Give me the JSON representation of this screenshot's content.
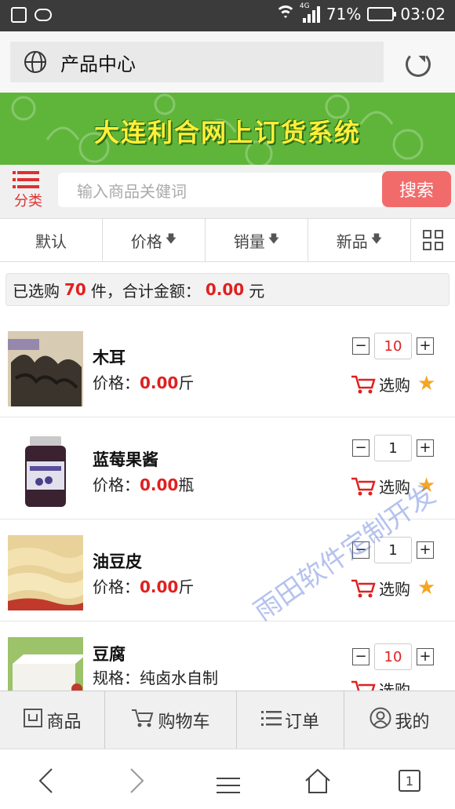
{
  "status_bar": {
    "network": "4G",
    "battery": "71%",
    "time": "03:02"
  },
  "browser": {
    "title": "产品中心"
  },
  "banner": {
    "text": "大连利合网上订货系统"
  },
  "search": {
    "category_label": "分类",
    "placeholder": "输入商品关健词",
    "button_label": "搜索"
  },
  "sort": {
    "items": [
      {
        "label": "默认",
        "arrow": ""
      },
      {
        "label": "价格",
        "arrow": "🡇"
      },
      {
        "label": "销量",
        "arrow": "🡇"
      },
      {
        "label": "新品",
        "arrow": "🡇"
      }
    ]
  },
  "summary": {
    "prefix": "已选购",
    "count": "70",
    "middle": "件，合计金额：",
    "amount": "0.00",
    "suffix": "元"
  },
  "products": [
    {
      "name": "木耳",
      "detail_label": "价格：",
      "price": "0.00",
      "unit": "斤",
      "qty": "10",
      "qty_highlight": true,
      "select_label": "选购"
    },
    {
      "name": "蓝莓果酱",
      "detail_label": "价格：",
      "price": "0.00",
      "unit": "瓶",
      "qty": "1",
      "qty_highlight": false,
      "select_label": "选购"
    },
    {
      "name": "油豆皮",
      "detail_label": "价格：",
      "price": "0.00",
      "unit": "斤",
      "qty": "1",
      "qty_highlight": false,
      "select_label": "选购"
    },
    {
      "name": "豆腐",
      "detail_label": "规格：",
      "price": "",
      "unit": "纯卤水自制",
      "qty": "10",
      "qty_highlight": true,
      "select_label": "选购"
    }
  ],
  "tabbar": {
    "items": [
      {
        "label": "商品",
        "icon": "product-icon"
      },
      {
        "label": "购物车",
        "icon": "cart-icon"
      },
      {
        "label": "订单",
        "icon": "list-icon"
      },
      {
        "label": "我的",
        "icon": "user-icon"
      }
    ]
  },
  "navbar": {
    "tab_count": "1"
  },
  "watermark": "雨田软件定制开发",
  "colors": {
    "accent_red": "#e02020",
    "search_button": "#f26b6b",
    "banner_green": "#5fb53a",
    "banner_text": "#ffef3a",
    "star": "#f5a623"
  }
}
